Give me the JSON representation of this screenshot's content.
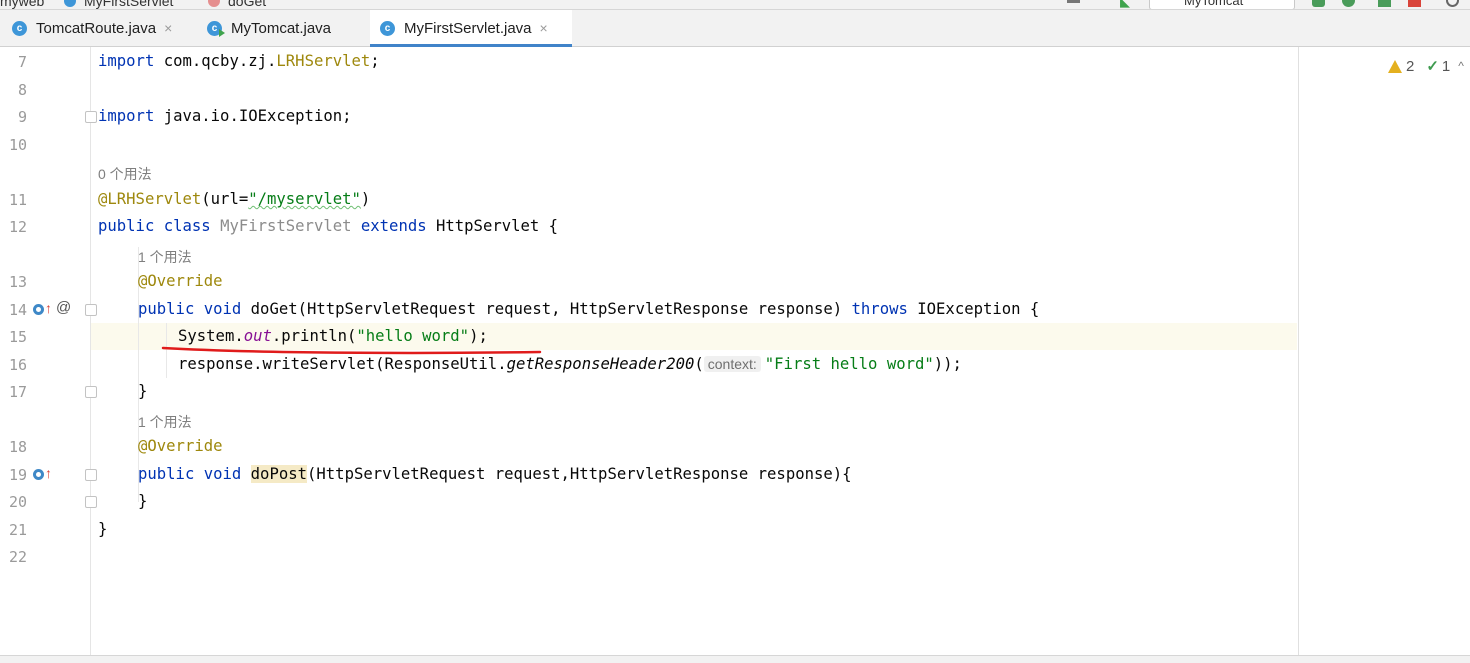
{
  "breadcrumb": [
    "myweb",
    "MyFirstServlet",
    "doGet"
  ],
  "run_config": "MyTomcat",
  "tabs": [
    {
      "label": "TomcatRoute.java",
      "close": "×"
    },
    {
      "label": "MyTomcat.java",
      "close": ""
    },
    {
      "label": "MyFirstServlet.java",
      "close": "×"
    }
  ],
  "inspections": {
    "warnings": "2",
    "checks": "1"
  },
  "usage_hints": {
    "class_usages": "0 个用法",
    "doget_usages": "1 个用法",
    "dopost_usages": "1 个用法"
  },
  "line_numbers": [
    "7",
    "8",
    "9",
    "10",
    "11",
    "12",
    "13",
    "14",
    "15",
    "16",
    "17",
    "18",
    "19",
    "20",
    "21",
    "22"
  ],
  "code": {
    "l7_kw": "import",
    "l7_pkg": " com.qcby.zj.",
    "l7_cls": "LRHServlet",
    "l7_end": ";",
    "l9_kw": "import",
    "l9_rest": " java.io.IOException;",
    "l11_ann": "@LRHServlet",
    "l11_a": "(url=",
    "l11_str": "\"/myservlet\"",
    "l11_b": ")",
    "l12_kw1": "public class ",
    "l12_name": "MyFirstServlet",
    "l12_kw2": " extends ",
    "l12_rest": "HttpServlet {",
    "l13_ann": "@Override",
    "l14_kw": "public void ",
    "l14_rest": "doGet(HttpServletRequest request, HttpServletResponse response) ",
    "l14_kw2": "throws",
    "l14_end": " IOException {",
    "l15_a": "System.",
    "l15_fld": "out",
    "l15_b": ".println(",
    "l15_str": "\"hello word\"",
    "l15_c": ");",
    "l16_a": "response.writeServlet(ResponseUtil.",
    "l16_stat": "getResponseHeader200",
    "l16_b": "(",
    "l16_inlay": "context:",
    "l16_str": "\"First hello word\"",
    "l16_c": "));",
    "l17": "}",
    "l18_ann": "@Override",
    "l19_kw": "public void ",
    "l19_name": "doPost",
    "l19_rest": "(HttpServletRequest request,HttpServletResponse response){",
    "l20": "}",
    "l21": "}"
  },
  "colors": {
    "keyword": "#0033b3",
    "annotation": "#9e880d",
    "string": "#067d17",
    "field": "#871094",
    "tab_accent": "#4083c9",
    "red_mark": "#e01b1b"
  }
}
